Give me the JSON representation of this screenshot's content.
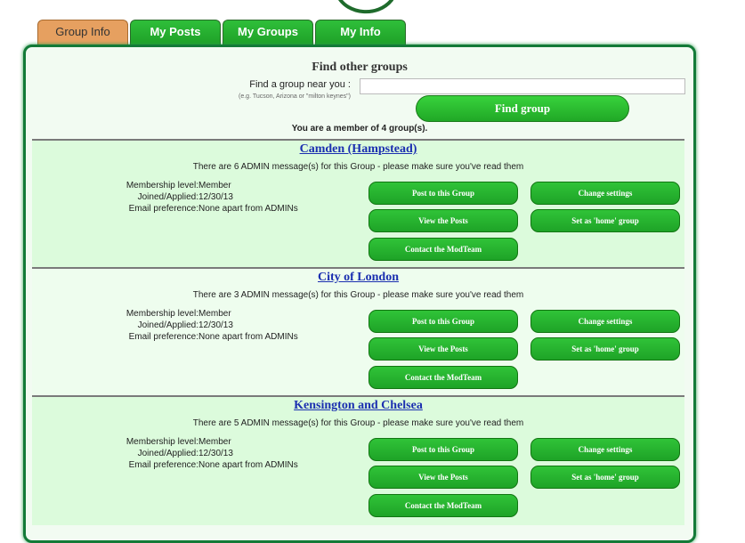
{
  "tabs": [
    {
      "label": "Group Info",
      "active": true
    },
    {
      "label": "My Posts",
      "active": false
    },
    {
      "label": "My Groups",
      "active": false
    },
    {
      "label": "My Info",
      "active": false
    }
  ],
  "find": {
    "title": "Find other groups",
    "label": "Find a group near you :",
    "hint": "(e.g. Tucson, Arizona or \"milton keynes\")",
    "input_value": "",
    "button": "Find group"
  },
  "member_count": "You are a member of 4 group(s).",
  "info_labels": {
    "membership": "Membership level:",
    "joined": "Joined/Applied:",
    "email": "Email preference:"
  },
  "buttons": {
    "post": "Post to this Group",
    "change": "Change settings",
    "view": "View the Posts",
    "home": "Set as 'home' group",
    "contact": "Contact the ModTeam"
  },
  "groups": [
    {
      "name": "Camden (Hampstead)",
      "message": "There are 6 ADMIN message(s) for this Group - please make sure you've read them",
      "membership": "Member",
      "joined": "12/30/13",
      "email": "None apart from ADMINs"
    },
    {
      "name": "City of London",
      "message": "There are 3 ADMIN message(s) for this Group - please make sure you've read them",
      "membership": "Member",
      "joined": "12/30/13",
      "email": "None apart from ADMINs"
    },
    {
      "name": "Kensington and Chelsea",
      "message": "There are 5 ADMIN message(s) for this Group - please make sure you've read them",
      "membership": "Member",
      "joined": "12/30/13",
      "email": "None apart from ADMINs"
    }
  ],
  "colors": {
    "accent_green": "#1ea327",
    "tab_active": "#e6a060",
    "link": "#1b2fb0"
  }
}
